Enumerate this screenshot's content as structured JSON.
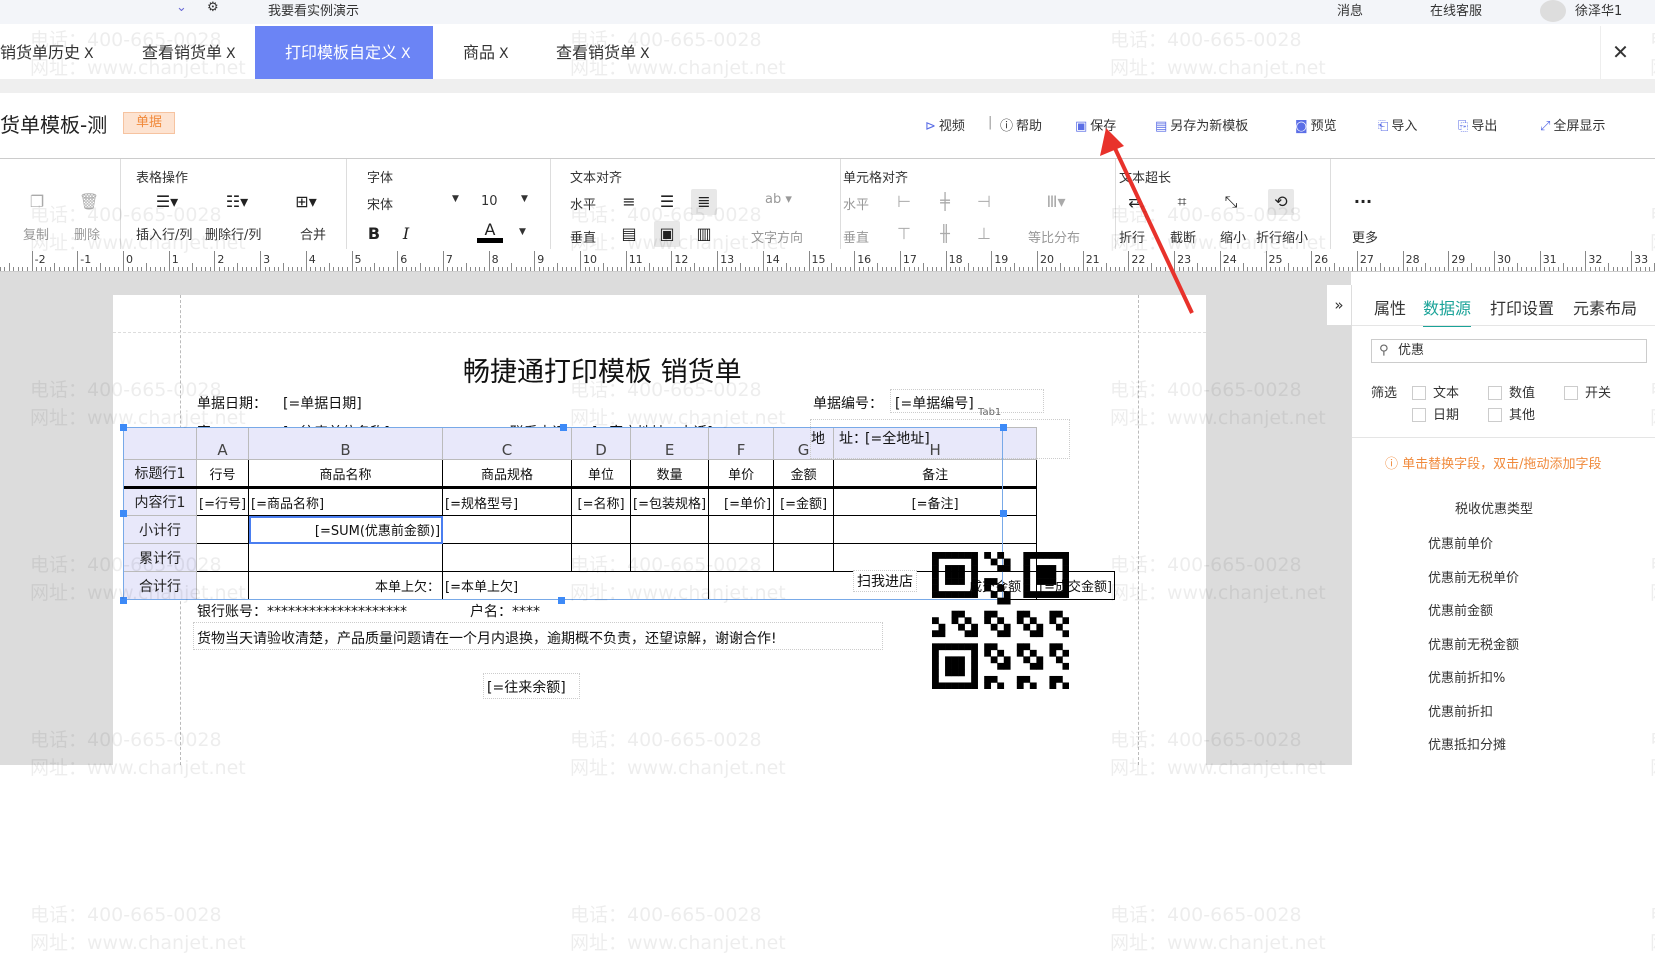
{
  "topbar": {
    "demo": "我要看实例演示",
    "messages": "消息",
    "support": "在线客服",
    "user": "徐泽华1"
  },
  "tabs": [
    {
      "label": "销货单历史"
    },
    {
      "label": "查看销货单"
    },
    {
      "label": "打印模板自定义",
      "active": true
    },
    {
      "label": "商品"
    },
    {
      "label": "查看销货单"
    }
  ],
  "tab_close": "X",
  "header": {
    "title": "货单模板-测",
    "badge": "单据",
    "actions": [
      {
        "icon": "play-icon",
        "label": "视频"
      },
      {
        "icon": "help-icon",
        "label": "帮助"
      },
      {
        "icon": "save-icon",
        "label": "保存"
      },
      {
        "icon": "save-as-icon",
        "label": "另存为新模板"
      },
      {
        "icon": "preview-icon",
        "label": "预览"
      },
      {
        "icon": "import-icon",
        "label": "导入"
      },
      {
        "icon": "export-icon",
        "label": "导出"
      },
      {
        "icon": "fullscreen-icon",
        "label": "全屏显示"
      }
    ]
  },
  "toolbar": {
    "clip": {
      "copy": "复制",
      "delete": "删除"
    },
    "table": {
      "title": "表格操作",
      "insert": "插入行/列",
      "remove": "删除行/列",
      "merge": "合并"
    },
    "font": {
      "title": "字体",
      "family": "宋体",
      "size": "10",
      "bold": "B",
      "italic": "I",
      "color_glyph": "A"
    },
    "text_align": {
      "title": "文本对齐",
      "horizontal": "水平",
      "vertical": "垂直",
      "direction": "文字方向",
      "direction_glyph": "ab"
    },
    "cell_align": {
      "title": "单元格对齐",
      "horizontal": "水平",
      "vertical": "垂直",
      "distribute": "等比分布"
    },
    "overflow": {
      "title": "文本超长",
      "wrap": "折行",
      "cut": "截断",
      "shrink": "缩小",
      "wrap_shrink": "折行缩小"
    },
    "more": {
      "label": "更多",
      "glyph": "···"
    }
  },
  "ruler": {
    "labels": [
      "-2",
      "-1",
      "0",
      "1",
      "2",
      "3",
      "4",
      "5",
      "6",
      "7",
      "8",
      "9",
      "10",
      "11",
      "12",
      "13",
      "14",
      "15",
      "16",
      "17",
      "18",
      "19",
      "20",
      "21",
      "22",
      "23",
      "24",
      "25",
      "26",
      "27",
      "28",
      "29",
      "30",
      "31",
      "32",
      "33"
    ]
  },
  "watermark": {
    "line1": "电话：400-665-0028",
    "line2": "网址：www.chanjet.net"
  },
  "form": {
    "title": "畅捷通打印模板 销货单",
    "date_label": "单据日期：",
    "date_value": "[=单据日期]",
    "no_label": "单据编号：",
    "no_value": "[=单据编号]",
    "tab_label": "Tab1",
    "customer_label": "客",
    "customer_value": "[=往来单位名称]",
    "phone_label": "联系电话：",
    "phone_value": "[=客户地址－电话]",
    "addr_label": "地　址：",
    "addr_value": "[=全地址]",
    "columns": [
      "A",
      "B",
      "C",
      "D",
      "E",
      "F",
      "G",
      "H"
    ],
    "row_headers": [
      "标题行1",
      "内容行1",
      "小计行",
      "累计行",
      "合计行"
    ],
    "title_row": [
      "行号",
      "商品名称",
      "商品规格",
      "单位",
      "数量",
      "单价",
      "金额",
      "备注"
    ],
    "content_row": [
      "[=行号]",
      "[=商品名称]",
      "[=规格型号]",
      "[=名称]",
      "[=包装规格]",
      "[=单价]",
      "[=金额]",
      "[=备注]"
    ],
    "subtotal_value": "[=SUM(优惠前金额)]",
    "owed_label": "本单上欠：",
    "owed_value": "[=本单上欠]",
    "deal_label": "成交金额：",
    "deal_value": "[=成交金额]",
    "scan_label": "扫我进店",
    "bank": "银行账号：********************",
    "account_name": "户名：****",
    "notice": "货物当天请验收清楚，产品质量问题请在一个月内退换，逾期概不负责，还望谅解，谢谢合作!",
    "balance": "[=往来余额]"
  },
  "panel": {
    "tabs": [
      {
        "label": "属性"
      },
      {
        "label": "数据源",
        "active": true
      },
      {
        "label": "打印设置"
      },
      {
        "label": "元素布局"
      }
    ],
    "search_value": "优惠",
    "filter_label": "筛选",
    "filters": [
      {
        "label": "文本",
        "checked": false
      },
      {
        "label": "数值",
        "checked": false
      },
      {
        "label": "开关",
        "checked": false
      },
      {
        "label": "日期",
        "checked": false
      },
      {
        "label": "其他",
        "checked": false
      }
    ],
    "hint": "单击替换字段，双击/拖动添加字段",
    "group": "税收优惠类型",
    "fields": [
      "优惠前单价",
      "优惠前无税单价",
      "优惠前金额",
      "优惠前无税金额",
      "优惠前折扣%",
      "优惠前折扣",
      "优惠抵扣分摊"
    ]
  },
  "colors": {
    "accent": "#6b84f5",
    "panel_accent": "#1aa398",
    "hint": "#f08a3c",
    "annotation_arrow": "#e8322b"
  }
}
